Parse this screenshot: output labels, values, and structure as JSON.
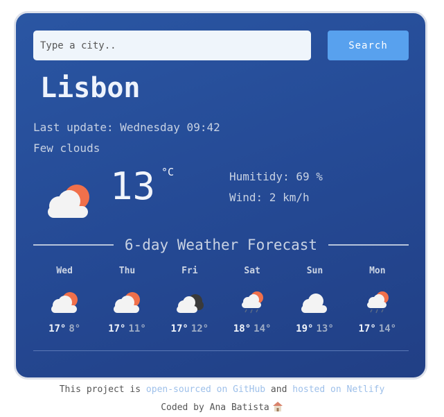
{
  "search": {
    "placeholder": "Type a city..",
    "button_label": "Search"
  },
  "current": {
    "city": "Lisbon",
    "last_update": "Last update: Wednesday 09:42",
    "description": "Few clouds",
    "temperature": "13",
    "unit": "°C",
    "humidity": "Humitidy: 69 %",
    "wind": "Wind: 2 km/h",
    "icon": "few-clouds-day-icon"
  },
  "forecast": {
    "title": "6-day Weather Forecast",
    "days": [
      {
        "day": "Wed",
        "max": "17°",
        "min": "8°",
        "icon": "few-clouds-day-icon"
      },
      {
        "day": "Thu",
        "max": "17°",
        "min": "11°",
        "icon": "few-clouds-day-icon"
      },
      {
        "day": "Fri",
        "max": "17°",
        "min": "12°",
        "icon": "broken-clouds-icon"
      },
      {
        "day": "Sat",
        "max": "18°",
        "min": "14°",
        "icon": "rain-day-icon"
      },
      {
        "day": "Sun",
        "max": "19°",
        "min": "13°",
        "icon": "cloud-icon"
      },
      {
        "day": "Mon",
        "max": "17°",
        "min": "14°",
        "icon": "rain-day-icon"
      }
    ]
  },
  "footer": {
    "text1": "This project is ",
    "link1": "open-sourced on GitHub",
    "text2": " and ",
    "link2": "hosted on Netlify",
    "credit": "Coded by Ana Batista",
    "credit_icon": "house-icon"
  },
  "colors": {
    "card_bg": "#2a56a3",
    "button": "#58a1ee",
    "sun": "#f0704b",
    "cloud": "#f3f3f3"
  }
}
